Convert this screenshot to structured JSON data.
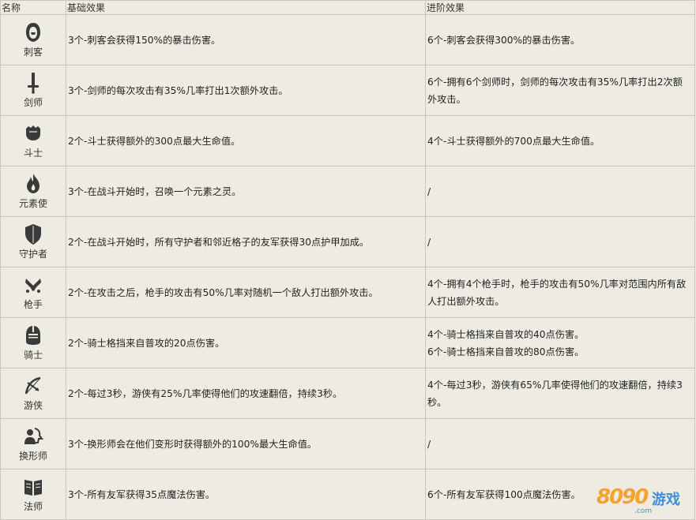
{
  "header": {
    "col_name": "名称",
    "col_base": "基础效果",
    "col_advanced": "进阶效果"
  },
  "rows": [
    {
      "icon": "hooded-assassin-icon",
      "name": "刺客",
      "base": [
        "3个-刺客会获得150%的暴击伤害。"
      ],
      "advanced": [
        "6个-刺客会获得300%的暴击伤害。"
      ]
    },
    {
      "icon": "sword-icon",
      "name": "剑师",
      "base": [
        "3个-剑师的每次攻击有35%几率打出1次额外攻击。"
      ],
      "advanced": [
        "6个-拥有6个剑师时，剑师的每次攻击有35%几率打出2次额外攻击。"
      ]
    },
    {
      "icon": "fist-icon",
      "name": "斗士",
      "base": [
        "2个-斗士获得额外的300点最大生命值。"
      ],
      "advanced": [
        "4个-斗士获得额外的700点最大生命值。"
      ]
    },
    {
      "icon": "flame-icon",
      "name": "元素使",
      "base": [
        "3个-在战斗开始时，召唤一个元素之灵。"
      ],
      "advanced": [
        "/"
      ]
    },
    {
      "icon": "shield-icon",
      "name": "守护者",
      "base": [
        "2个-在战斗开始时，所有守护者和邻近格子的友军获得30点护甲加成。"
      ],
      "advanced": [
        "/"
      ]
    },
    {
      "icon": "crossed-guns-icon",
      "name": "枪手",
      "base": [
        "2个-在攻击之后，枪手的攻击有50%几率对随机一个敌人打出额外攻击。"
      ],
      "advanced": [
        "4个-拥有4个枪手时，枪手的攻击有50%几率对范围内所有敌人打出额外攻击。"
      ]
    },
    {
      "icon": "knight-helmet-icon",
      "name": "骑士",
      "base": [
        "2个-骑士格挡来自普攻的20点伤害。"
      ],
      "advanced": [
        "4个-骑士格挡来自普攻的40点伤害。",
        "6个-骑士格挡来自普攻的80点伤害。"
      ]
    },
    {
      "icon": "bow-arrow-icon",
      "name": "游侠",
      "base": [
        "2个-每过3秒，游侠有25%几率使得他们的攻速翻倍，持续3秒。"
      ],
      "advanced": [
        "4个-每过3秒，游侠有65%几率使得他们的攻速翻倍，持续3秒。"
      ]
    },
    {
      "icon": "shapeshifter-icon",
      "name": "换形师",
      "base": [
        "3个-换形师会在他们变形时获得额外的100%最大生命值。"
      ],
      "advanced": [
        "/"
      ]
    },
    {
      "icon": "book-icon",
      "name": "法师",
      "base": [
        "3个-所有友军获得35点魔法伤害。"
      ],
      "advanced": [
        "6个-所有友军获得100点魔法伤害。"
      ]
    }
  ],
  "watermark": {
    "digits": "8090",
    "text": "游戏",
    "url": ".com"
  },
  "colors": {
    "background": "#eeece2",
    "border": "#c9c7bb",
    "icon": "#3a3a3a",
    "watermark_orange": "#f4a32b",
    "watermark_blue": "#3f8ed8"
  }
}
